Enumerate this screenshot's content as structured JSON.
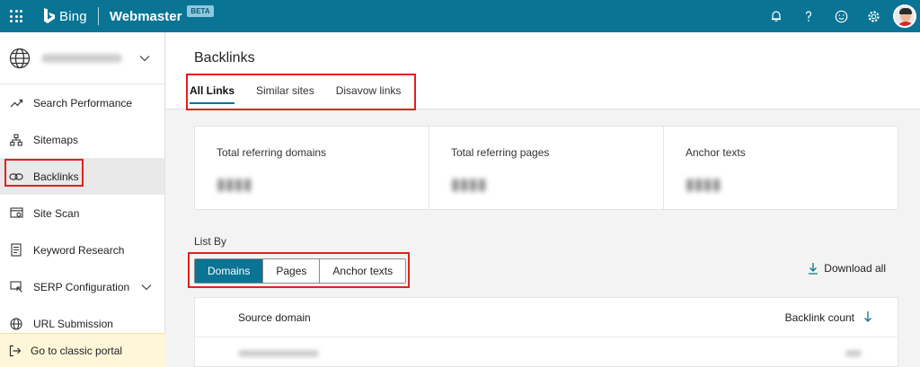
{
  "topbar": {
    "brand_bing": "Bing",
    "brand_product": "Webmaster",
    "beta_badge": "BETA",
    "accent_color": "#0a7494"
  },
  "sidebar": {
    "items": [
      {
        "label": "Search Performance",
        "icon": "trend-icon"
      },
      {
        "label": "Sitemaps",
        "icon": "sitemap-icon"
      },
      {
        "label": "Backlinks",
        "icon": "link-icon",
        "active": true
      },
      {
        "label": "Site Scan",
        "icon": "scan-icon"
      },
      {
        "label": "Keyword Research",
        "icon": "document-icon"
      },
      {
        "label": "SERP Configuration",
        "icon": "serp-icon",
        "expandable": true
      },
      {
        "label": "URL Submission",
        "icon": "globe-icon"
      }
    ],
    "classic_label": "Go to classic portal"
  },
  "main": {
    "title": "Backlinks",
    "tabs": [
      {
        "label": "All Links",
        "active": true
      },
      {
        "label": "Similar sites"
      },
      {
        "label": "Disavow links"
      }
    ],
    "stats": [
      {
        "label": "Total referring domains"
      },
      {
        "label": "Total referring pages"
      },
      {
        "label": "Anchor texts"
      }
    ],
    "list_by_label": "List By",
    "segments": [
      {
        "label": "Domains",
        "active": true
      },
      {
        "label": "Pages"
      },
      {
        "label": "Anchor texts"
      }
    ],
    "download_label": "Download all",
    "table": {
      "col_source": "Source domain",
      "col_count": "Backlink count"
    }
  },
  "highlight_color": "#e41f1f"
}
